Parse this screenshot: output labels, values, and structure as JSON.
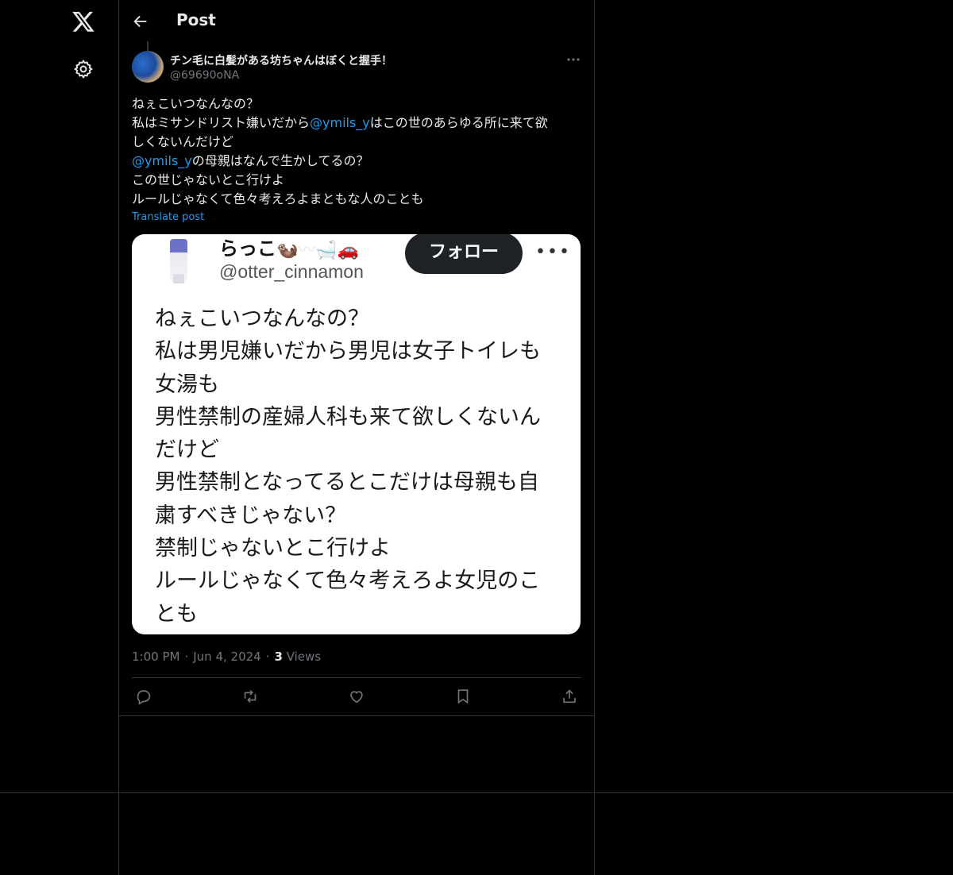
{
  "header": {
    "title": "Post"
  },
  "post": {
    "author_name": "チン毛に白髪がある坊ちゃんはぼくと握手！",
    "author_handle": "@69690oNA",
    "body": {
      "line1": "ねぇこいつなんなの？",
      "line2_a": "私はミサンドリスト嫌いだから",
      "line2_mention": "@ymils_y",
      "line2_b": "はこの世のあらゆる所に来て欲",
      "line3": "しくないんだけど",
      "line4_mention": "@ymils_y",
      "line4_b": "の母親はなんで生かしてるの？",
      "line5": "この世じゃないとこ行けよ",
      "line6": "ルールじゃなくて色々考えろよまともな人のことも"
    },
    "translate_label": "Translate post",
    "time": "1:00 PM",
    "date": "Jun 4, 2024",
    "views_count": "3",
    "views_label": "Views"
  },
  "embedded_image": {
    "name": "らっこ",
    "emoji": "🦦〰🛁🚗",
    "handle": "@otter_cinnamon",
    "follow_label": "フォロー",
    "lines": [
      "ねぇこいつなんなの？",
      "私は男児嫌いだから男児は女子トイレも",
      "女湯も",
      "男性禁制の産婦人科も来て欲しくないん",
      "だけど",
      "男性禁制となってるとこだけは母親も自",
      "粛すべきじゃない？",
      "禁制じゃないとこ行けよ",
      "ルールじゃなくて色々考えろよ女児のこ",
      "とも"
    ]
  },
  "icons": {
    "logo": "x-logo-icon",
    "settings": "gear-icon",
    "back": "arrow-left-icon",
    "more": "more-horizontal-icon",
    "reply": "reply-icon",
    "repost": "repost-icon",
    "like": "heart-icon",
    "bookmark": "bookmark-icon",
    "share": "share-icon"
  }
}
